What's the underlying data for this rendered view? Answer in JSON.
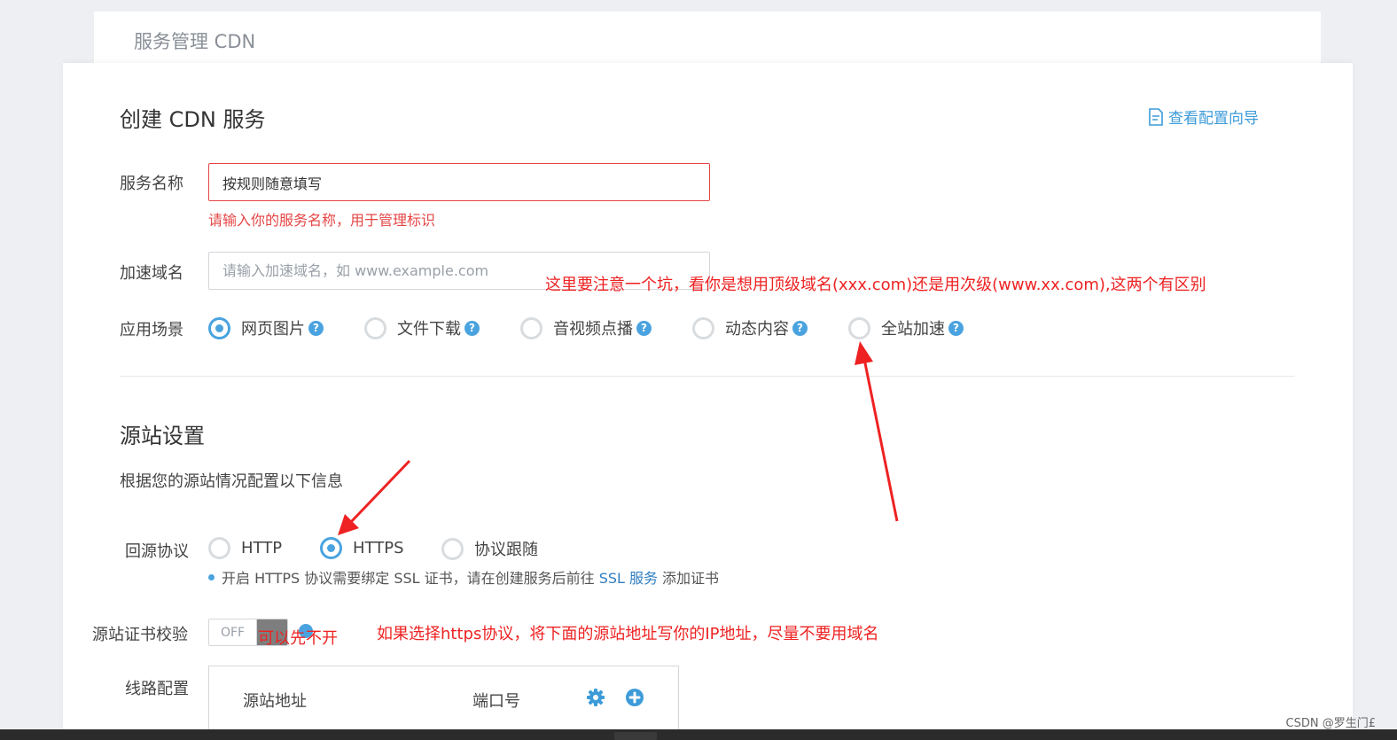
{
  "breadcrumb": "服务管理 CDN",
  "page_title": "创建 CDN 服务",
  "guide_link": "查看配置向导",
  "service_name": {
    "label": "服务名称",
    "value": "按规则随意填写",
    "error": "请输入你的服务名称，用于管理标识"
  },
  "domain": {
    "label": "加速域名",
    "placeholder": "请输入加速域名，如 www.example.com"
  },
  "scene": {
    "label": "应用场景",
    "options": [
      "网页图片",
      "文件下载",
      "音视频点播",
      "动态内容",
      "全站加速"
    ],
    "selected": "网页图片"
  },
  "origin": {
    "title": "源站设置",
    "desc": "根据您的源站情况配置以下信息",
    "protocol_label": "回源协议",
    "protocol_options": [
      "HTTP",
      "HTTPS",
      "协议跟随"
    ],
    "protocol_selected": "HTTPS",
    "note_prefix": "开启 HTTPS 协议需要绑定 SSL 证书，请在创建服务后前往",
    "note_link": "SSL 服务",
    "note_suffix": "添加证书",
    "cert_label": "源站证书校验",
    "cert_toggle": "OFF",
    "line_label": "线路配置",
    "line_col_address": "源站地址",
    "line_col_port": "端口号"
  },
  "annotations": {
    "domain_tip": "这里要注意一个坑，看你是想用顶级域名(xxx.com)还是用次级(www.xx.com),这两个有区别",
    "cert_tip": "可以先不开",
    "https_tip": "如果选择https协议，将下面的源站地址写你的IP地址，尽量不要用域名"
  },
  "watermark": "CSDN @罗生门£",
  "colors": {
    "accent": "#4aa3df",
    "error": "#e64545",
    "annotation": "#ee2222"
  }
}
